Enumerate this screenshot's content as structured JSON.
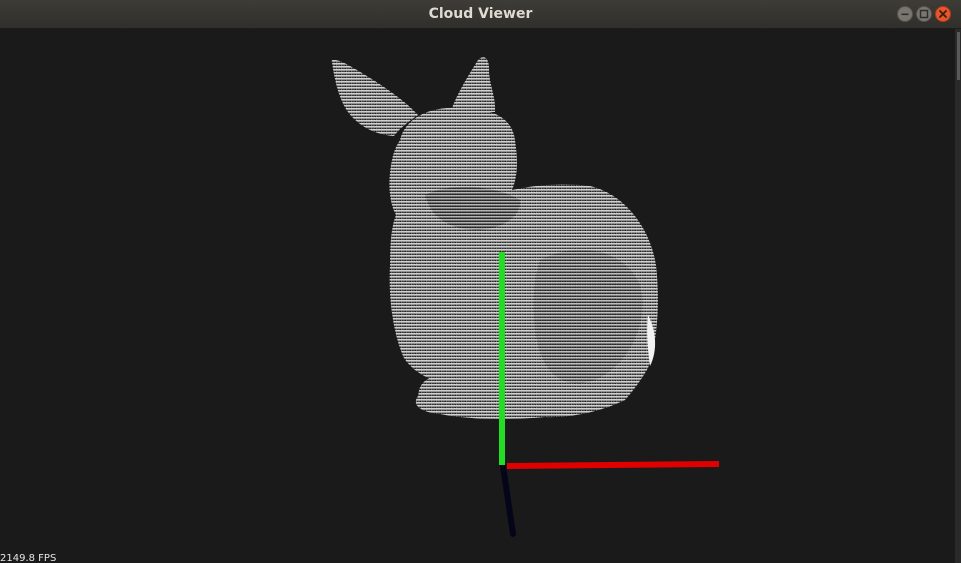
{
  "window": {
    "title": "Cloud Viewer",
    "controls": {
      "minimize": "minimize-icon",
      "maximize": "maximize-icon",
      "close": "close-icon"
    }
  },
  "viewer": {
    "fps_label": "2149.8 FPS",
    "background_color": "#1a1a1a",
    "point_color": "#d9d9d9",
    "axes": {
      "x_color": "#e00000",
      "y_color": "#22dd22",
      "z_color": "#05051a"
    }
  }
}
